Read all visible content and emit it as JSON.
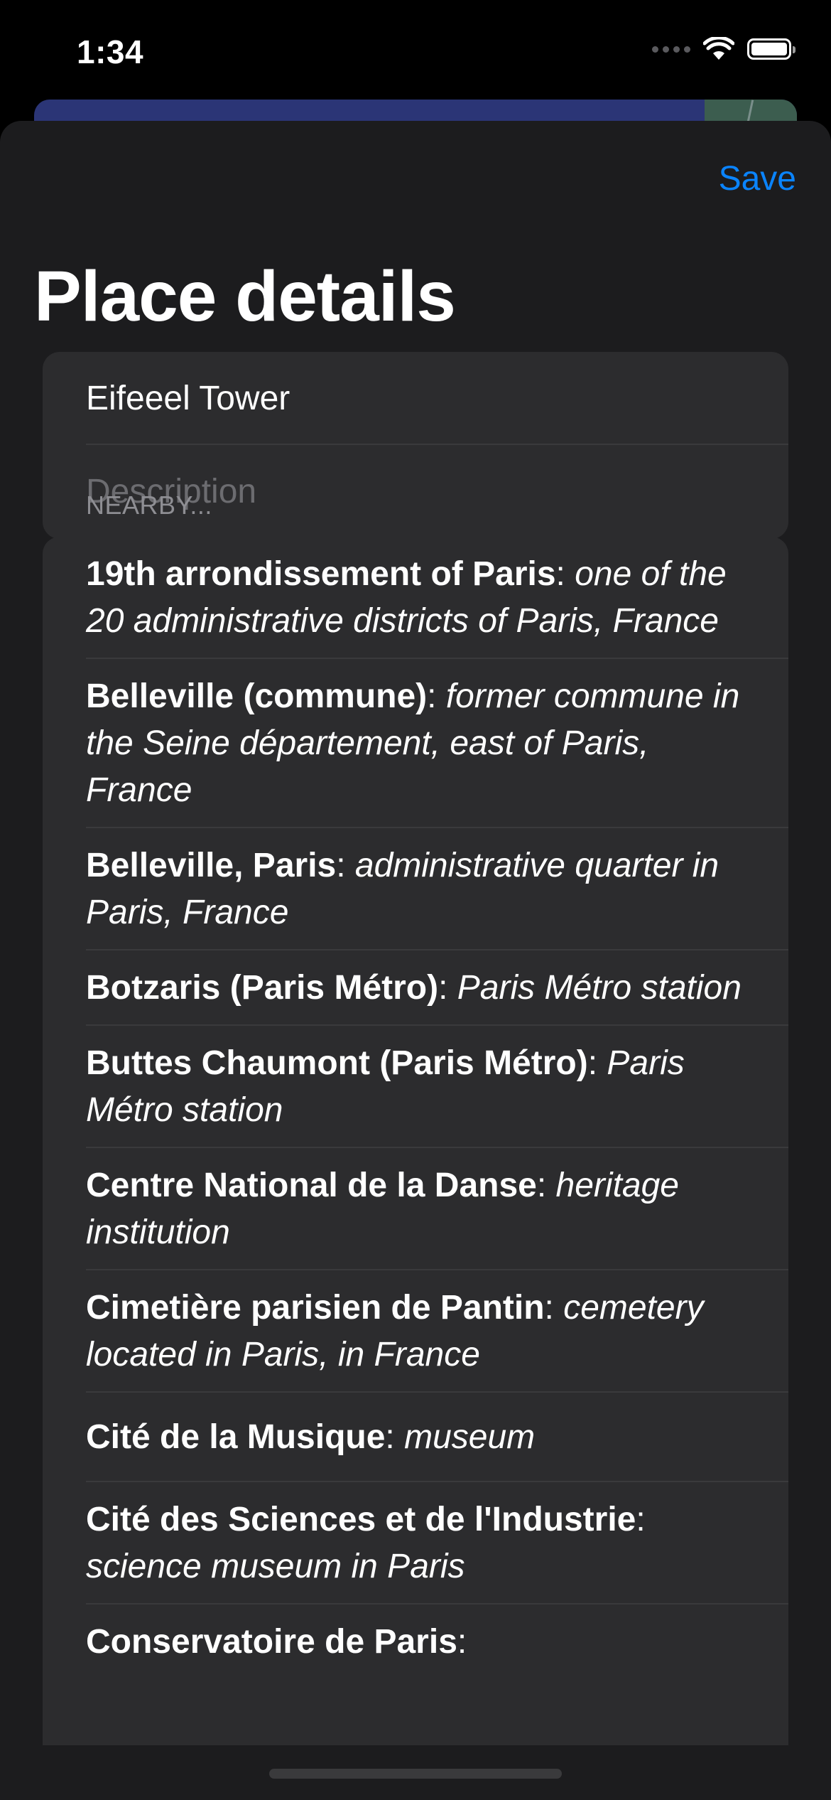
{
  "status_bar": {
    "time": "1:34"
  },
  "icons": {
    "signal": "cellular-signal-icon",
    "wifi": "wifi-icon",
    "battery": "battery-icon"
  },
  "colors": {
    "background": "#1c1c1e",
    "grouped_background": "#2c2c2e",
    "accent": "#0a84ff",
    "text_primary": "#ffffff",
    "text_secondary": "#8e8e93",
    "placeholder": "#6c6c70"
  },
  "nav": {
    "save_label": "Save"
  },
  "page": {
    "title": "Place details"
  },
  "form": {
    "name_value": "Eifeeel Tower",
    "description_value": "",
    "description_placeholder": "Description"
  },
  "nearby": {
    "header": "NEARBY...",
    "items": [
      {
        "name": "19th arrondissement of Paris",
        "separator": ": ",
        "description": "one of the 20 administrative districts of Paris, France"
      },
      {
        "name": "Belleville (commune)",
        "separator": ": ",
        "description": "former commune in the Seine département, east of Paris, France"
      },
      {
        "name": "Belleville, Paris",
        "separator": ": ",
        "description": "administrative quarter in Paris, France"
      },
      {
        "name": "Botzaris (Paris Métro)",
        "separator": ": ",
        "description": "Paris Métro station"
      },
      {
        "name": "Buttes Chaumont (Paris Métro)",
        "separator": ": ",
        "description": "Paris Métro station"
      },
      {
        "name": "Centre National de la Danse",
        "separator": ": ",
        "description": "heritage institution"
      },
      {
        "name": "Cimetière parisien de Pantin",
        "separator": ": ",
        "description": "cemetery located in Paris, in France"
      },
      {
        "name": "Cité de la Musique",
        "separator": ": ",
        "description": "museum"
      },
      {
        "name": "Cité des Sciences et de l'Industrie",
        "separator": ": ",
        "description": "science museum in Paris"
      },
      {
        "name": "Conservatoire de Paris",
        "separator": ": ",
        "description": ""
      }
    ]
  }
}
